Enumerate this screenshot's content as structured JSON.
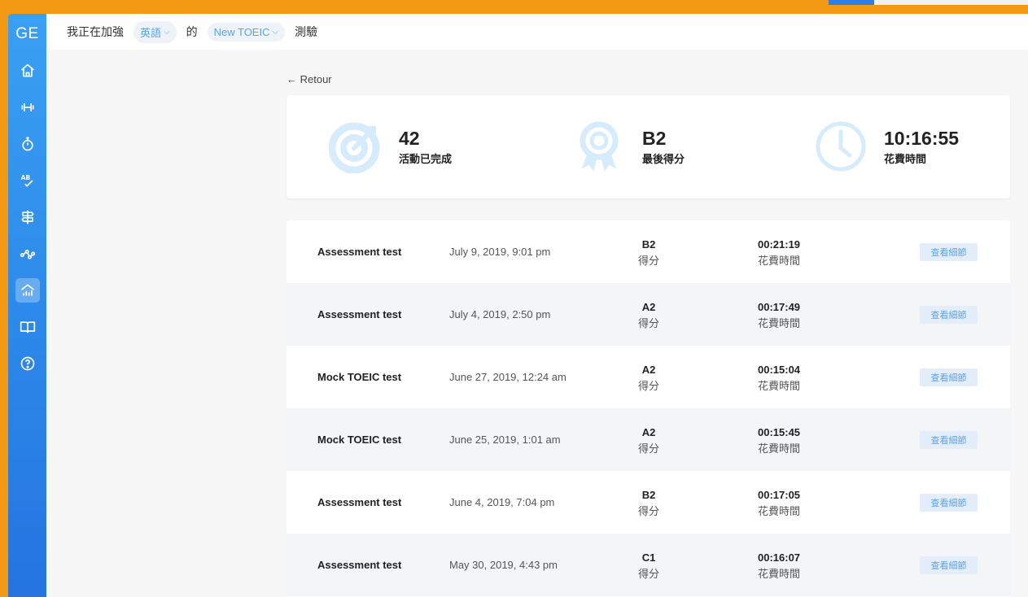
{
  "app": {
    "logo": "GE"
  },
  "topbar": {
    "prefix": "我正在加強",
    "language": "英語",
    "connector": "的",
    "exam": "New TOEIC",
    "suffix": "測驗"
  },
  "sidebar": {
    "items": [
      {
        "icon": "home-icon"
      },
      {
        "icon": "dumbbell-icon"
      },
      {
        "icon": "stopwatch-icon"
      },
      {
        "icon": "spellcheck-icon"
      },
      {
        "icon": "signpost-icon"
      },
      {
        "icon": "network-icon"
      },
      {
        "icon": "stats-icon",
        "active": true
      },
      {
        "icon": "book-icon"
      },
      {
        "icon": "help-icon"
      }
    ]
  },
  "back": {
    "label": "← Retour"
  },
  "stats": {
    "activities": {
      "value": "42",
      "label": "活動已完成"
    },
    "score": {
      "value": "B2",
      "label": "最後得分"
    },
    "time": {
      "value": "10:16:55",
      "label": "花費時間"
    }
  },
  "rows": [
    {
      "name": "Assessment test",
      "date": "July 9, 2019, 9:01 pm",
      "score": "B2",
      "score_label": "得分",
      "time": "00:21:19",
      "time_label": "花費時間",
      "button": "查看細節"
    },
    {
      "name": "Assessment test",
      "date": "July 4, 2019, 2:50 pm",
      "score": "A2",
      "score_label": "得分",
      "time": "00:17:49",
      "time_label": "花費時間",
      "button": "查看細節"
    },
    {
      "name": "Mock TOEIC test",
      "date": "June 27, 2019, 12:24 am",
      "score": "A2",
      "score_label": "得分",
      "time": "00:15:04",
      "time_label": "花費時間",
      "button": "查看細節"
    },
    {
      "name": "Mock TOEIC test",
      "date": "June 25, 2019, 1:01 am",
      "score": "A2",
      "score_label": "得分",
      "time": "00:15:45",
      "time_label": "花費時間",
      "button": "查看細節"
    },
    {
      "name": "Assessment test",
      "date": "June 4, 2019, 7:04 pm",
      "score": "B2",
      "score_label": "得分",
      "time": "00:17:05",
      "time_label": "花費時間",
      "button": "查看細節"
    },
    {
      "name": "Assessment test",
      "date": "May 30, 2019, 4:43 pm",
      "score": "C1",
      "score_label": "得分",
      "time": "00:16:07",
      "time_label": "花費時間",
      "button": "查看細節"
    }
  ],
  "colors": {
    "frame": "#f39a14",
    "sidebar": "#2b86e8",
    "accent": "#5aa3ea",
    "button_bg": "#e4eefa",
    "stat_icon": "#d6ebfb"
  }
}
